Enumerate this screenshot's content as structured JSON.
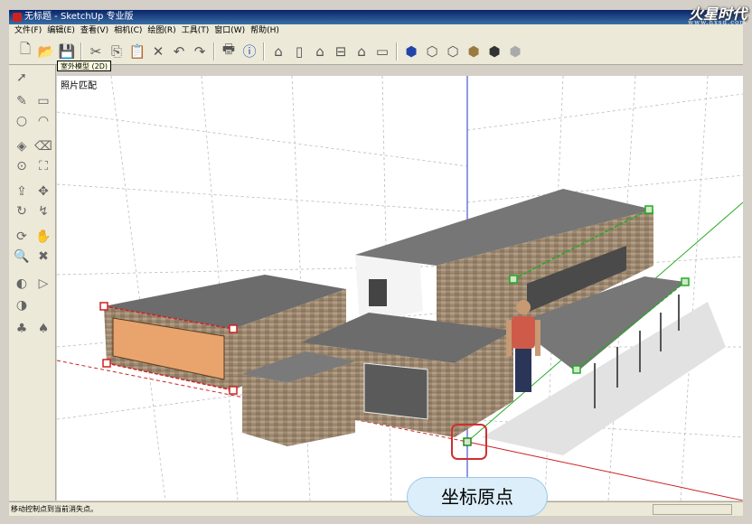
{
  "window": {
    "title": "无标题 - SketchUp 专业版"
  },
  "watermark": {
    "brand": "火星时代",
    "url": "www.hxsd.com"
  },
  "menu": {
    "items": [
      "文件(F)",
      "编辑(E)",
      "查看(V)",
      "相机(C)",
      "绘图(R)",
      "工具(T)",
      "窗口(W)",
      "帮助(H)"
    ]
  },
  "tooltip": {
    "text": "室外模型 (2D)"
  },
  "scene": {
    "label": "照片匹配"
  },
  "status": {
    "message": "移动控制点到当前消失点。"
  },
  "callout": {
    "text": "坐标原点"
  },
  "colors": {
    "axis_red": "#cc2222",
    "axis_green": "#22aa22",
    "axis_blue": "#2233cc",
    "callout_bg": "#dceefa"
  }
}
